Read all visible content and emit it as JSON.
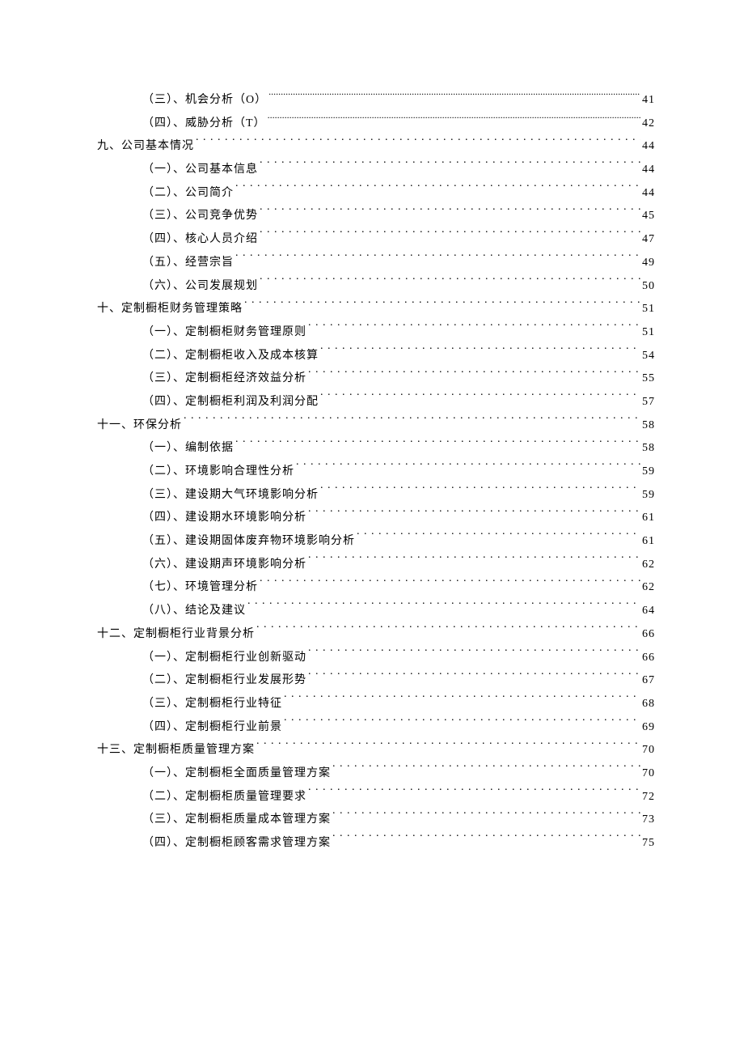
{
  "entries": [
    {
      "level": 2,
      "dense": true,
      "title": "（三）、机会分析（O）",
      "page": "41"
    },
    {
      "level": 2,
      "dense": true,
      "title": "（四）、威胁分析（T）",
      "page": "42"
    },
    {
      "level": 1,
      "dense": false,
      "title": "九、公司基本情况",
      "page": "44"
    },
    {
      "level": 2,
      "dense": false,
      "title": "（一）、公司基本信息",
      "page": "44"
    },
    {
      "level": 2,
      "dense": false,
      "title": "（二）、公司简介",
      "page": "44"
    },
    {
      "level": 2,
      "dense": false,
      "title": "（三）、公司竞争优势",
      "page": "45"
    },
    {
      "level": 2,
      "dense": false,
      "title": "（四）、核心人员介绍",
      "page": "47"
    },
    {
      "level": 2,
      "dense": false,
      "title": "（五）、经营宗旨",
      "page": "49"
    },
    {
      "level": 2,
      "dense": false,
      "title": "（六）、公司发展规划",
      "page": "50"
    },
    {
      "level": 1,
      "dense": false,
      "title": "十、定制橱柜财务管理策略",
      "page": "51"
    },
    {
      "level": 2,
      "dense": false,
      "title": "（一）、定制橱柜财务管理原则",
      "page": "51"
    },
    {
      "level": 2,
      "dense": false,
      "title": "（二）、定制橱柜收入及成本核算",
      "page": "54"
    },
    {
      "level": 2,
      "dense": false,
      "title": "（三）、定制橱柜经济效益分析",
      "page": "55"
    },
    {
      "level": 2,
      "dense": false,
      "title": "（四）、定制橱柜利润及利润分配",
      "page": "57"
    },
    {
      "level": 1,
      "dense": false,
      "title": "十一、环保分析",
      "page": "58"
    },
    {
      "level": 2,
      "dense": false,
      "title": "（一）、编制依据",
      "page": "58"
    },
    {
      "level": 2,
      "dense": false,
      "title": "（二）、环境影响合理性分析",
      "page": "59"
    },
    {
      "level": 2,
      "dense": false,
      "title": "（三）、建设期大气环境影响分析",
      "page": "59"
    },
    {
      "level": 2,
      "dense": false,
      "title": "（四）、建设期水环境影响分析",
      "page": "61"
    },
    {
      "level": 2,
      "dense": false,
      "title": "（五）、建设期固体废弃物环境影响分析",
      "page": "61"
    },
    {
      "level": 2,
      "dense": false,
      "title": "（六）、建设期声环境影响分析",
      "page": "62"
    },
    {
      "level": 2,
      "dense": false,
      "title": "（七）、环境管理分析",
      "page": "62"
    },
    {
      "level": 2,
      "dense": false,
      "title": "（八）、结论及建议",
      "page": "64"
    },
    {
      "level": 1,
      "dense": false,
      "title": "十二、定制橱柜行业背景分析",
      "page": "66"
    },
    {
      "level": 2,
      "dense": false,
      "title": "（一）、定制橱柜行业创新驱动",
      "page": "66"
    },
    {
      "level": 2,
      "dense": false,
      "title": "（二）、定制橱柜行业发展形势",
      "page": "67"
    },
    {
      "level": 2,
      "dense": false,
      "title": "（三）、定制橱柜行业特征",
      "page": "68"
    },
    {
      "level": 2,
      "dense": false,
      "title": "（四）、定制橱柜行业前景",
      "page": "69"
    },
    {
      "level": 1,
      "dense": false,
      "title": "十三、定制橱柜质量管理方案",
      "page": "70"
    },
    {
      "level": 2,
      "dense": false,
      "title": "（一）、定制橱柜全面质量管理方案",
      "page": "70"
    },
    {
      "level": 2,
      "dense": false,
      "title": "（二）、定制橱柜质量管理要求",
      "page": "72"
    },
    {
      "level": 2,
      "dense": false,
      "title": "（三）、定制橱柜质量成本管理方案",
      "page": "73"
    },
    {
      "level": 2,
      "dense": false,
      "title": "（四）、定制橱柜顾客需求管理方案",
      "page": "75"
    }
  ]
}
